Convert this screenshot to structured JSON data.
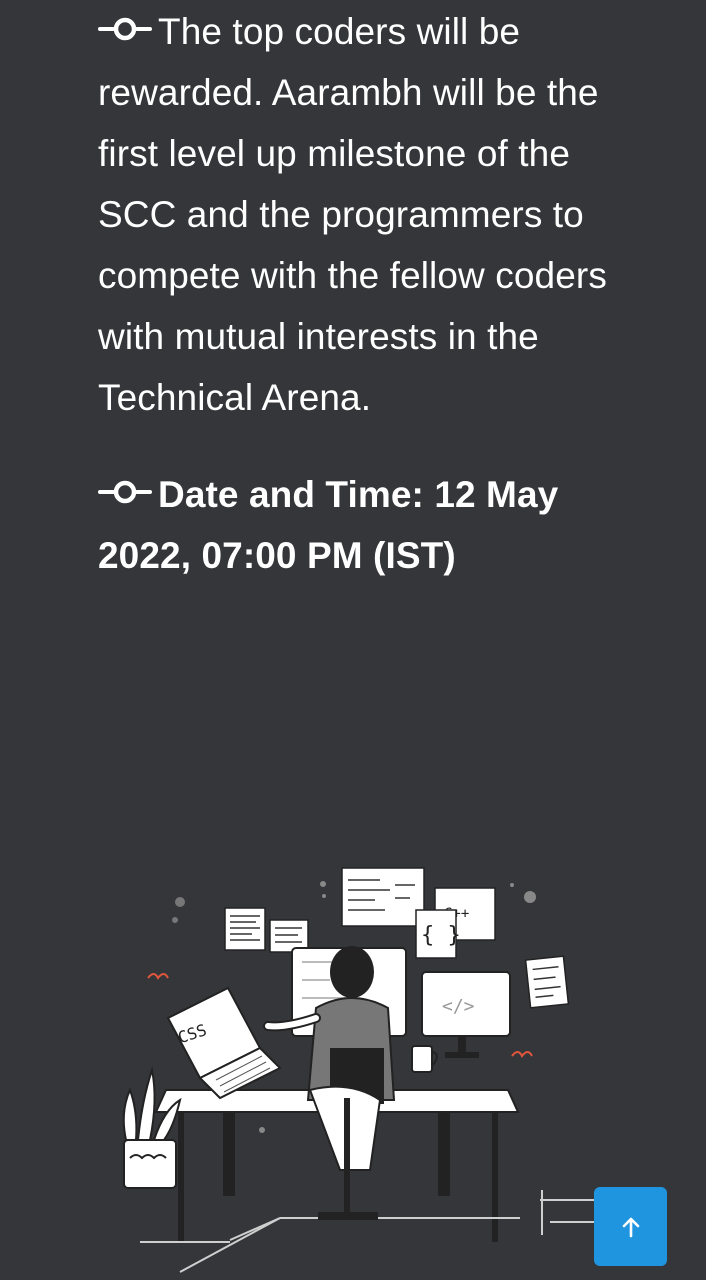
{
  "paragraphs": {
    "reward": "The top coders will be rewarded. Aarambh will be the first level up milestone of the SCC and the programmers to compete with the fellow coders with mutual interests in the Technical Arena.",
    "datetime": "Date and Time: 12 May 2022, 07:00 PM (IST)"
  },
  "illustration": {
    "laptop_text": "CSS",
    "note_text": "C++",
    "icon": "programmer-at-desk-illustration"
  },
  "scroll_button": {
    "icon": "arrow-up-icon",
    "color": "#1f95e0"
  },
  "colors": {
    "background": "#35363a",
    "text": "#ffffff"
  }
}
